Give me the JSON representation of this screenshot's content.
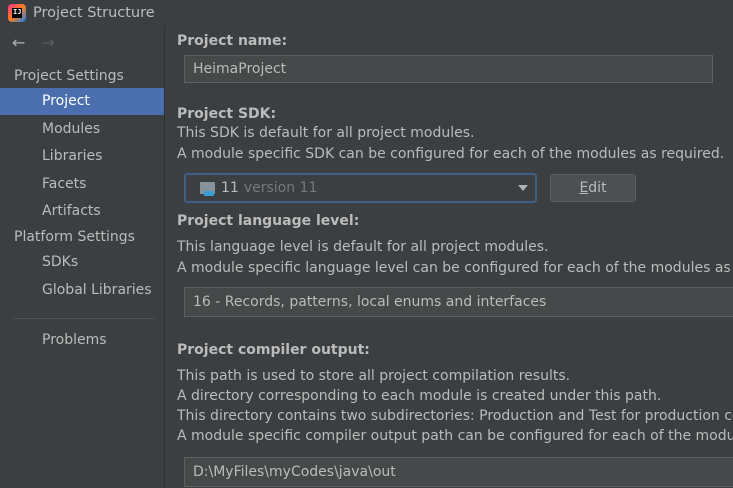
{
  "window": {
    "title": "Project Structure"
  },
  "sidebar": {
    "nav": {
      "back_icon": "arrow-left-icon",
      "forward_icon": "arrow-right-icon"
    },
    "project_settings_label": "Project Settings",
    "project_settings_items": [
      "Project",
      "Modules",
      "Libraries",
      "Facets",
      "Artifacts"
    ],
    "platform_settings_label": "Platform Settings",
    "platform_settings_items": [
      "SDKs",
      "Global Libraries"
    ],
    "problems_label": "Problems",
    "selected": "Project"
  },
  "main": {
    "project_name": {
      "label": "Project name:",
      "value": "HeimaProject"
    },
    "sdk": {
      "label": "Project SDK:",
      "desc1": "This SDK is default for all project modules.",
      "desc2": "A module specific SDK can be configured for each of the modules as required.",
      "selected_name": "11",
      "selected_version": "version 11",
      "edit_prefix": "",
      "edit_mnemonic": "E",
      "edit_rest": "dit"
    },
    "language_level": {
      "label": "Project language level:",
      "desc1": "This language level is default for all project modules.",
      "desc2": "A module specific language level can be configured for each of the modules as re",
      "value": "16 - Records, patterns, local enums and interfaces"
    },
    "compiler_output": {
      "label": "Project compiler output:",
      "desc1": "This path is used to store all project compilation results.",
      "desc2": "A directory corresponding to each module is created under this path.",
      "desc3": "This directory contains two subdirectories: Production and Test for production co",
      "desc4": "A module specific compiler output path can be configured for each of the modul",
      "value": "D:\\MyFiles\\myCodes\\java\\out"
    }
  },
  "colors": {
    "selection": "#4b6eaf",
    "background": "#3c3f41",
    "focus_border": "#3d6185"
  }
}
